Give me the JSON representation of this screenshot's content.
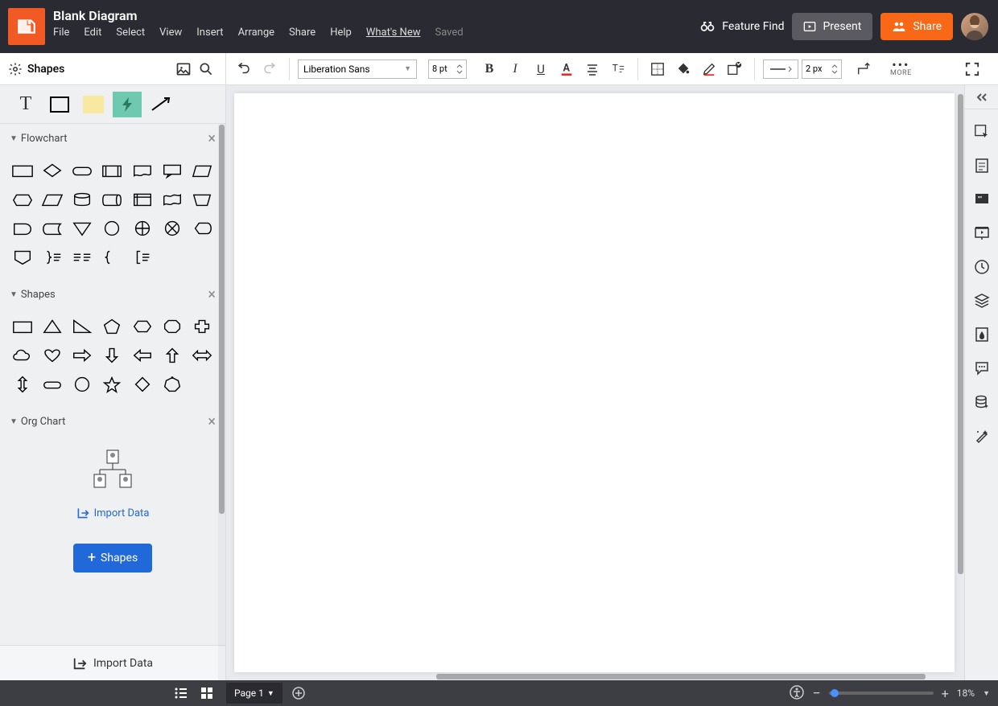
{
  "header": {
    "title": "Blank Diagram",
    "menu": [
      "File",
      "Edit",
      "Select",
      "View",
      "Insert",
      "Arrange",
      "Share",
      "Help"
    ],
    "whatsnew": "What's New",
    "saved": "Saved",
    "featureFind": "Feature Find",
    "present": "Present",
    "share": "Share"
  },
  "toolbarLeft": {
    "label": "Shapes"
  },
  "toolbar": {
    "font": "Liberation Sans",
    "fontSize": "8 pt",
    "lineWidth": "2 px",
    "more": "MORE"
  },
  "sections": {
    "flowchart": "Flowchart",
    "shapes": "Shapes",
    "orgchart": "Org Chart"
  },
  "orgImport": "Import Data",
  "addShapes": "Shapes",
  "importData": "Import Data",
  "footer": {
    "page": "Page 1",
    "zoom": "18%"
  }
}
